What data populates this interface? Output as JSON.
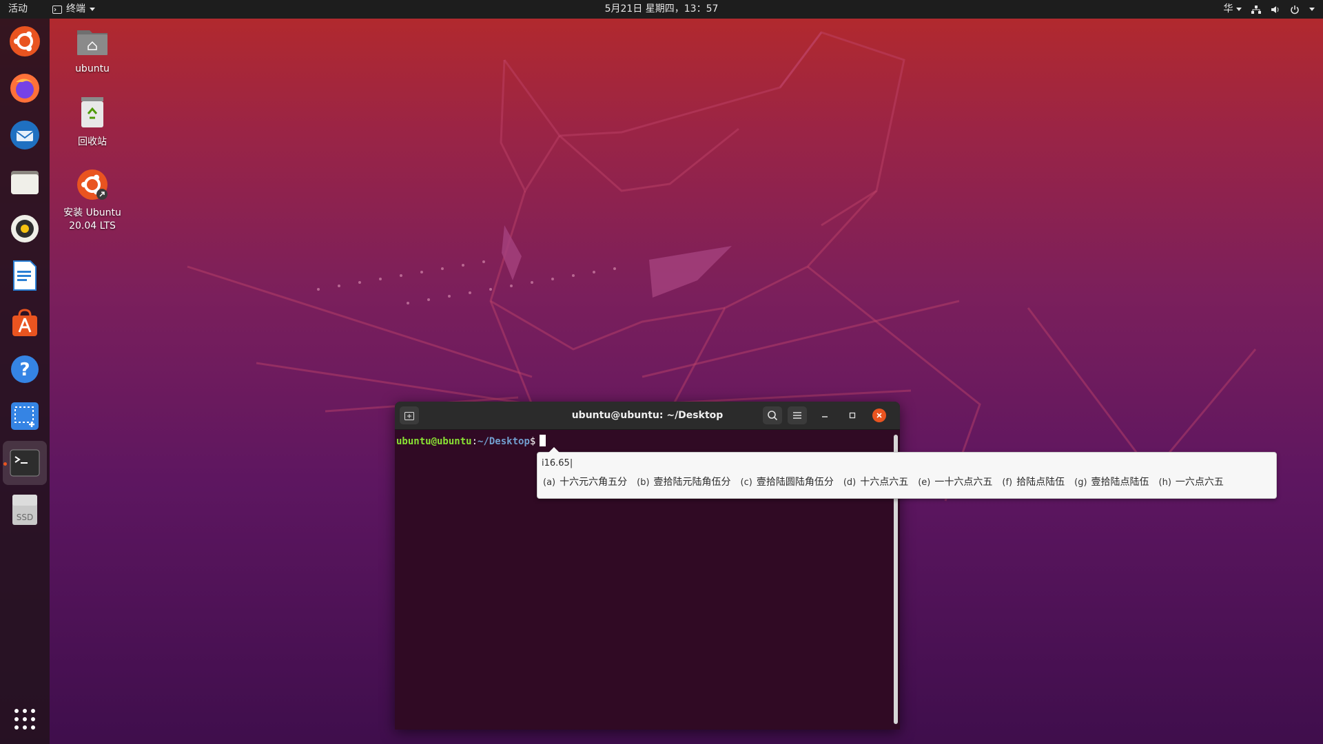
{
  "topbar": {
    "activities": "活动",
    "app_name": "终端",
    "clock": "5月21日 星期四，13：57",
    "input_method": "华"
  },
  "desktop": {
    "icons": [
      {
        "label": "ubuntu"
      },
      {
        "label": "回收站"
      },
      {
        "label": "安装 Ubuntu 20.04 LTS"
      }
    ]
  },
  "dock": {
    "items": [
      "ubuntu-installer",
      "firefox",
      "thunderbird",
      "files",
      "rhythmbox",
      "libreoffice-writer",
      "software-center",
      "help",
      "screenshot",
      "terminal",
      "ssd-drive"
    ],
    "ssd_label": "SSD"
  },
  "terminal": {
    "title": "ubuntu@ubuntu: ~/Desktop",
    "prompt_user": "ubuntu@ubuntu",
    "prompt_colon": ":",
    "prompt_path": "~/Desktop",
    "prompt_symbol": "$"
  },
  "ime": {
    "input": "i16.65|",
    "candidates": [
      {
        "label": "(a)",
        "text": "十六元六角五分"
      },
      {
        "label": "(b)",
        "text": "壹拾陆元陆角伍分"
      },
      {
        "label": "(c)",
        "text": "壹拾陆圆陆角伍分"
      },
      {
        "label": "(d)",
        "text": "十六点六五"
      },
      {
        "label": "(e)",
        "text": "一十六点六五"
      },
      {
        "label": "(f)",
        "text": "拾陆点陆伍"
      },
      {
        "label": "(g)",
        "text": "壹拾陆点陆伍"
      },
      {
        "label": "(h)",
        "text": "一六点六五"
      }
    ]
  },
  "colors": {
    "ubuntu_orange": "#e95420",
    "terminal_bg": "#300a24",
    "prompt_green": "#8ae234",
    "prompt_blue": "#729fcf"
  }
}
